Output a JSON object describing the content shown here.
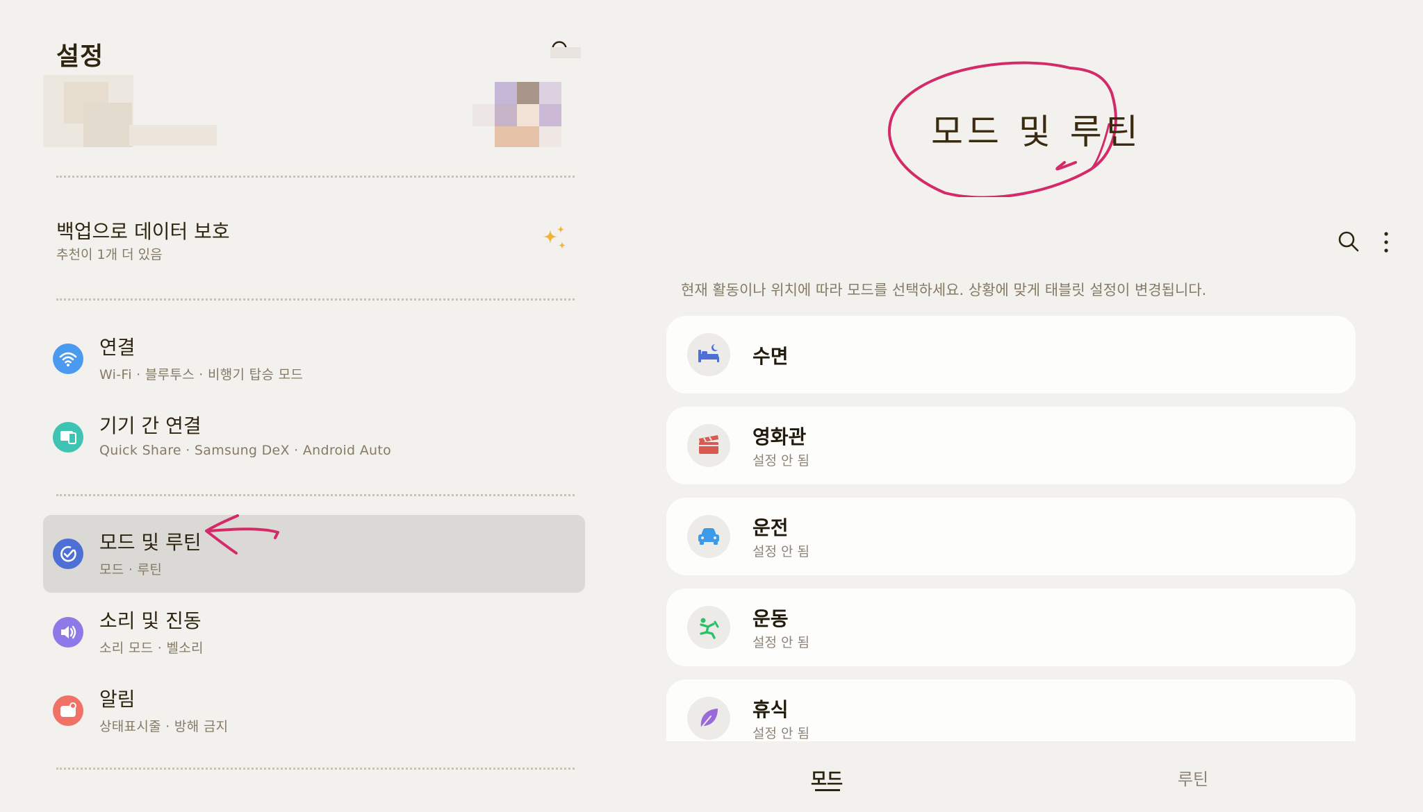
{
  "left": {
    "title": "설정",
    "backup": {
      "title": "백업으로 데이터 보호",
      "subtitle": "추천이 1개 더 있음"
    },
    "groups": [
      {
        "items": [
          {
            "title": "연결",
            "subtitle": "Wi-Fi  ·  블루투스  ·  비행기 탑승 모드",
            "icon": "wifi-icon",
            "color": "#4a9af0"
          },
          {
            "title": "기기 간 연결",
            "subtitle": "Quick Share  ·  Samsung DeX  ·  Android Auto",
            "icon": "devices-icon",
            "color": "#3fc3b3"
          }
        ]
      },
      {
        "items": [
          {
            "title": "모드 및 루틴",
            "subtitle": "모드  ·  루틴",
            "icon": "modes-routines-icon",
            "color": "#4e6fd6",
            "selected": true
          },
          {
            "title": "소리 및 진동",
            "subtitle": "소리 모드  ·  벨소리",
            "icon": "speaker-icon",
            "color": "#8d7ae8"
          },
          {
            "title": "알림",
            "subtitle": "상태표시줄  ·  방해 금지",
            "icon": "notification-icon",
            "color": "#f07166"
          }
        ]
      }
    ]
  },
  "right": {
    "heading": "모드 및 루틴",
    "description": "현재 활동이나 위치에 따라 모드를 선택하세요. 상황에 맞게 태블릿 설정이 변경됩니다.",
    "modes": [
      {
        "title": "수면",
        "subtitle": "",
        "icon": "bed-icon",
        "color": "#4e6fd6"
      },
      {
        "title": "영화관",
        "subtitle": "설정 안 됨",
        "icon": "clapperboard-icon",
        "color": "#d85a52"
      },
      {
        "title": "운전",
        "subtitle": "설정 안 됨",
        "icon": "car-icon",
        "color": "#3d9ae8"
      },
      {
        "title": "운동",
        "subtitle": "설정 안 됨",
        "icon": "running-icon",
        "color": "#2bc06a"
      },
      {
        "title": "휴식",
        "subtitle": "설정 안 됨",
        "icon": "leaf-icon",
        "color": "#9a6ad8"
      }
    ],
    "tabs": [
      {
        "label": "모드",
        "active": true
      },
      {
        "label": "루틴",
        "active": false
      }
    ]
  },
  "colors": {
    "annotation": "#d42a6a",
    "background": "#f3f1ed",
    "selected_row": "#dbd9d5"
  }
}
